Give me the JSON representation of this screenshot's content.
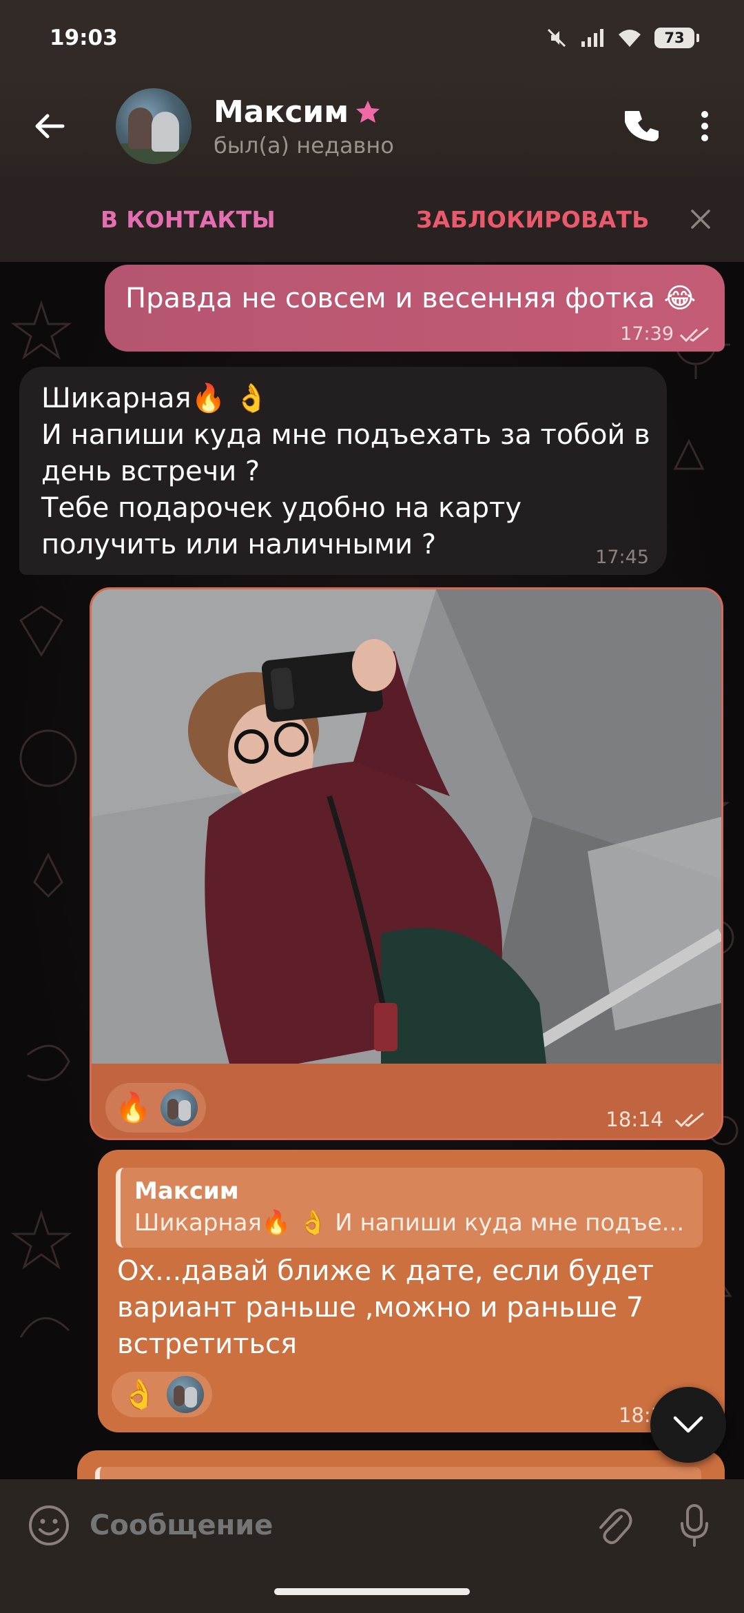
{
  "status_bar": {
    "time": "19:03",
    "battery": "73",
    "icons": [
      "mute-icon",
      "signal-icon",
      "wifi-icon",
      "battery-icon"
    ]
  },
  "header": {
    "contact_name": "Максим",
    "contact_status": "был(а) недавно",
    "star_color": "#f06aa8"
  },
  "action_bar": {
    "add_contact": "В КОНТАКТЫ",
    "block": "ЗАБЛОКИРОВАТЬ"
  },
  "messages": [
    {
      "direction": "out",
      "text": "Правда не совсем и весенняя фотка 😂",
      "time": "17:39",
      "read": true
    },
    {
      "direction": "in",
      "lines": [
        "Шикарная🔥 👌",
        "И напиши куда мне подъехать за тобой в",
        "день встречи ?",
        "Тебе подарочек удобно на карту",
        "получить или наличными ?"
      ],
      "time": "17:45"
    },
    {
      "direction": "out",
      "type": "photo",
      "reaction": "🔥",
      "time": "18:14",
      "read": true
    },
    {
      "direction": "out",
      "reply_to": {
        "name": "Максим",
        "text": "Шикарная🔥 👌 И напиши куда мне подъе..."
      },
      "lines": [
        "Ох...давай ближе к дате, если будет",
        "вариант раньше ,можно и раньше 7",
        "встретиться"
      ],
      "reaction": "👌",
      "time": "18:1"
    }
  ],
  "input": {
    "placeholder": "Сообщение"
  },
  "colors": {
    "accent_pink": "#e36fb0",
    "block_red": "#e95b6c",
    "outgoing_bubble": "#cc7040",
    "incoming_bubble": "#231f20"
  }
}
